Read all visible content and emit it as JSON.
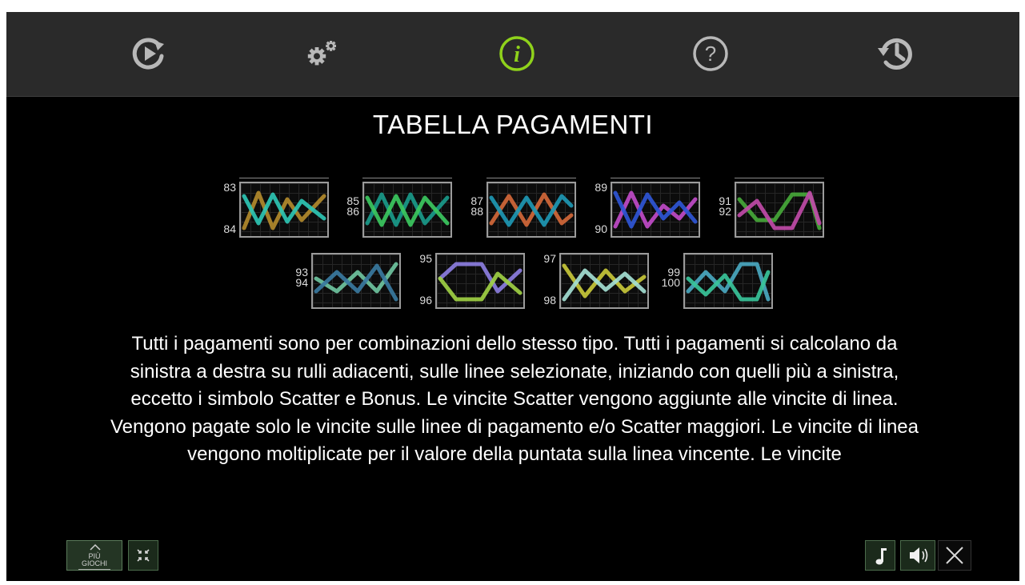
{
  "page": {
    "title": "TABELLA PAGAMENTI"
  },
  "nav": {
    "items": [
      {
        "name": "autoplay-icon",
        "active": false
      },
      {
        "name": "settings-icon",
        "active": false
      },
      {
        "name": "info-icon",
        "active": true
      },
      {
        "name": "help-icon",
        "active": false
      },
      {
        "name": "history-icon",
        "active": false
      }
    ],
    "active_color": "#8fd21b",
    "inactive_color": "#b8b8b8"
  },
  "paylines": {
    "row1": [
      {
        "top": "83",
        "bottom": "84",
        "colors": [
          "#b28a2c",
          "#2ec6b4"
        ]
      },
      {
        "top": "85",
        "bottom": "86",
        "colors": [
          "#1a9a8a",
          "#3cc860"
        ]
      },
      {
        "top": "87",
        "bottom": "88",
        "colors": [
          "#d2683a",
          "#1e98b4"
        ]
      },
      {
        "top": "89",
        "bottom": "90",
        "colors": [
          "#c04bc8",
          "#2f56d6"
        ]
      },
      {
        "top": "91",
        "bottom": "92",
        "colors": [
          "#46a83a",
          "#c04ba8"
        ]
      }
    ],
    "row2": [
      {
        "top": "93",
        "bottom": "94",
        "colors": [
          "#6fc4a0",
          "#3a7aa0"
        ]
      },
      {
        "top": "95",
        "bottom": "96",
        "colors": [
          "#8c7ee0",
          "#9fd044"
        ]
      },
      {
        "top": "97",
        "bottom": "98",
        "colors": [
          "#c8c83a",
          "#a4e0d4"
        ]
      },
      {
        "top": "99",
        "bottom": "100",
        "colors": [
          "#4aa8c0",
          "#3ac49a"
        ]
      }
    ]
  },
  "description": "Tutti i pagamenti sono per combinazioni dello stesso tipo. Tutti i pagamenti si calcolano da sinistra a destra su rulli adiacenti, sulle linee selezionate, iniziando con quelli più a sinistra, eccetto i simbolo Scatter e Bonus. Le vincite Scatter vengono aggiunte alle vincite di linea. Vengono pagate solo le vincite sulle linee di pagamento e/o Scatter maggiori. Le vincite di linea vengono moltiplicate per il valore della puntata sulla linea vincente. Le vincite",
  "bottom": {
    "more_games_line1": "PIÙ",
    "more_games_line2": "GIOCHI",
    "icons": [
      "fullscreen-exit-icon",
      "music-note-icon",
      "speaker-icon",
      "close-icon"
    ]
  }
}
